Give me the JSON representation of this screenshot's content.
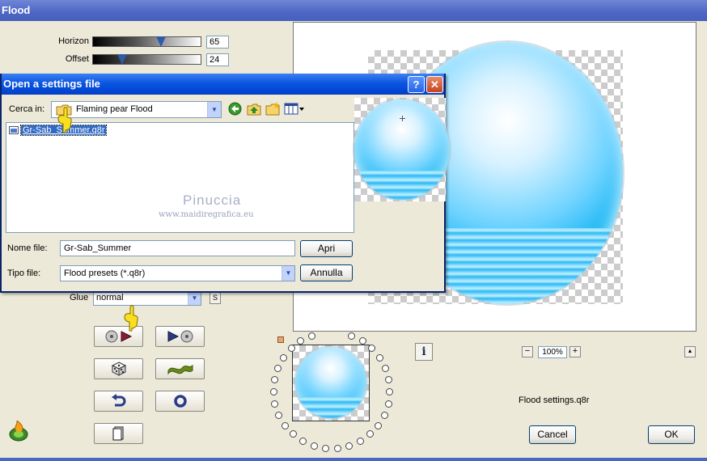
{
  "window": {
    "title": "Flood"
  },
  "params": [
    {
      "label": "Horizon",
      "value": "65",
      "fraction": 0.63
    },
    {
      "label": "Offset",
      "value": "24",
      "fraction": 0.27
    }
  ],
  "glue": {
    "label": "Glue",
    "value": "normal",
    "side_button": "S"
  },
  "preview": {
    "zoom": "100%",
    "settings_file": "Flood settings.q8r"
  },
  "buttons": {
    "cancel": "Cancel",
    "ok": "OK",
    "info": "i"
  },
  "icons": {
    "open-settings": "open-settings-icon",
    "save-settings": "save-settings-icon",
    "randomize": "dice-icon",
    "mutate": "wave-icon",
    "undo": "undo-icon",
    "reset": "ring-icon",
    "clipboard": "clipboard-icon",
    "flaming-pear-logo": "flame-logo-icon"
  },
  "colors": {
    "title_bar": "#4c66c4",
    "dialog_title_bar": "#0c56e0",
    "selection": "#316ac5",
    "water": "#16b5f3"
  },
  "dialog": {
    "title": "Open a settings file",
    "help": "?",
    "close": "✕",
    "look_in_label": "Cerca in:",
    "look_in_value": "Flaming pear Flood",
    "files": [
      {
        "name": "Gr-Sab_Summer.q8r",
        "selected": true
      }
    ],
    "watermark_name": "Pinuccia",
    "watermark_url": "www.maidiregrafica.eu",
    "filename_label": "Nome file:",
    "filename_value": "Gr-Sab_Summer",
    "filetype_label": "Tipo file:",
    "filetype_value": "Flood presets (*.q8r)",
    "open_button": "Apri",
    "cancel_button": "Annulla"
  }
}
